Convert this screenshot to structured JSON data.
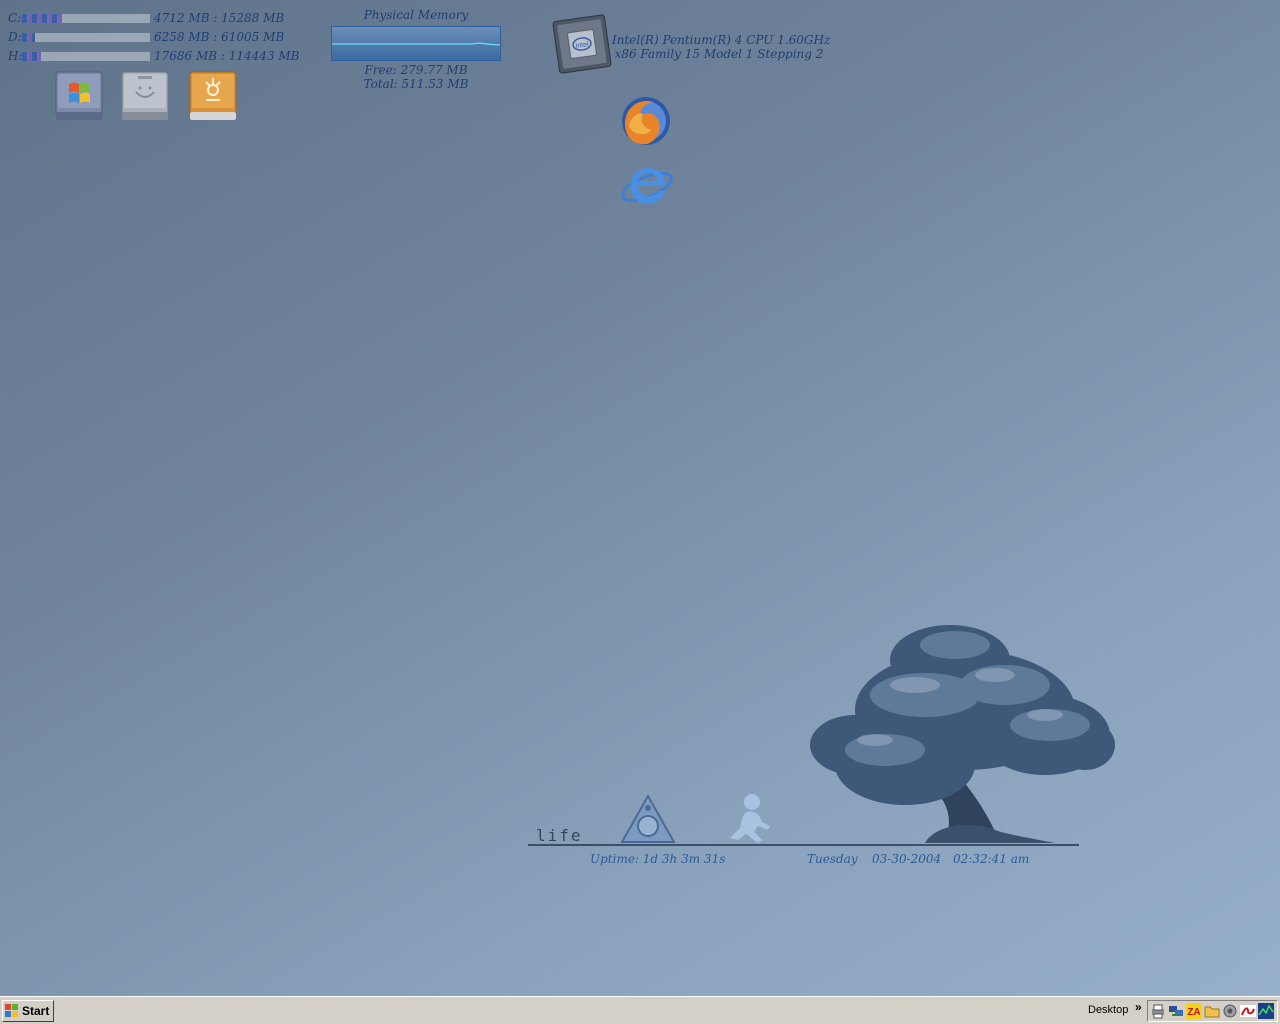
{
  "drives": [
    {
      "letter": "C:",
      "label": "4712 MB : 15288 MB",
      "used_fraction": 0.31
    },
    {
      "letter": "D:",
      "label": "6258 MB : 61005 MB",
      "used_fraction": 0.1
    },
    {
      "letter": "H:",
      "label": "17686 MB : 114443 MB",
      "used_fraction": 0.15
    }
  ],
  "drive_icons": [
    "windows-drive-icon",
    "hard-drive-icon",
    "firewire-drive-icon"
  ],
  "memory": {
    "title": "Physical Memory",
    "free": "Free: 279.77 MB",
    "total": "Total: 511.53 MB"
  },
  "cpu": {
    "line1": "Intel(R) Pentium(R) 4 CPU 1.60GHz",
    "line2": "x86 Family 15 Model 1 Stepping 2",
    "icon": "cpu-chip-icon"
  },
  "apps": [
    "firefox-icon",
    "internet-explorer-icon"
  ],
  "life": {
    "label": "life",
    "uptime": "Uptime: 1d 3h 3m 31s",
    "day": "Tuesday",
    "date": "03-30-2004",
    "time": "02:32:41 am"
  },
  "taskbar": {
    "start_label": "Start",
    "toolbar_label": "Desktop",
    "chevron": "»",
    "tray_icons": [
      "printer-icon",
      "network-icon",
      "zonealarm-icon",
      "folder-icon",
      "speaker-icon",
      "acrobat-icon",
      "monitor-icon"
    ]
  },
  "colors": {
    "text_blue": "#1f3f73",
    "taskbar": "#d4d0c8"
  }
}
